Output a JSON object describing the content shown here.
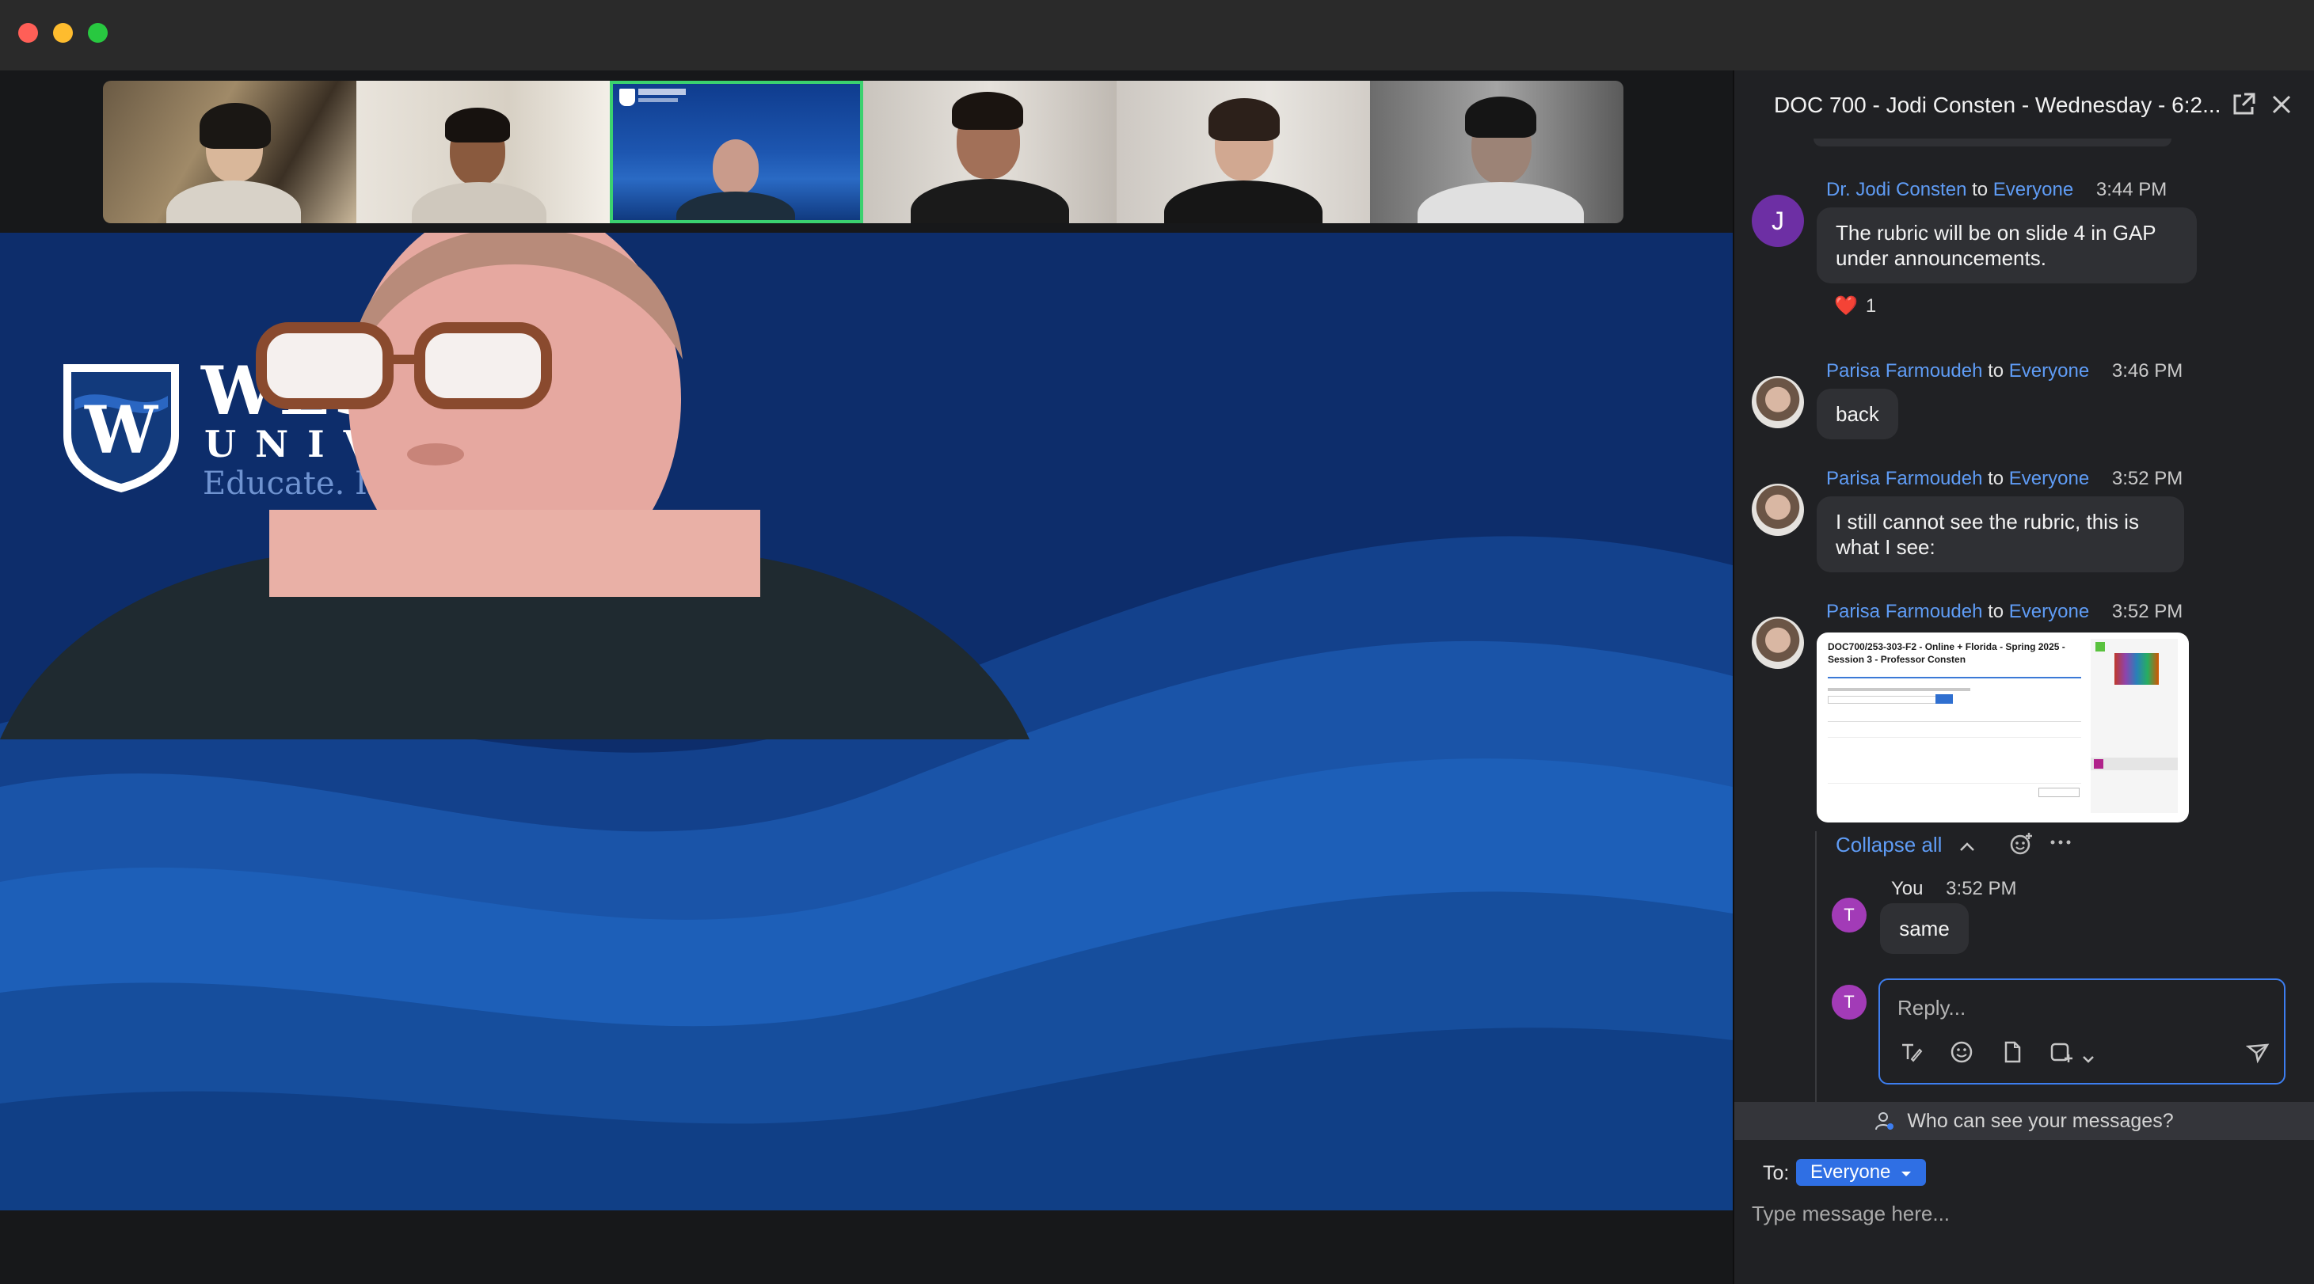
{
  "window": {
    "controls": [
      "close",
      "minimize",
      "zoom"
    ]
  },
  "video_strip": {
    "tiles": [
      "participant-1",
      "participant-2",
      "participant-3-active",
      "participant-4",
      "participant-5",
      "participant-6"
    ],
    "active_tile_color": "#3bd16f"
  },
  "main_video": {
    "logo_name": "WESTCLIFF",
    "logo_sub": "UNIVERSITY",
    "logo_tagline": "Educate. Inspire. Empower.",
    "background_color": "#0d2d6b"
  },
  "chat": {
    "title": "DOC 700 - Jodi Consten - Wednesday - 6:2...",
    "popout_icon": "popout-icon",
    "close_icon": "close-icon",
    "messages": [
      {
        "sender": "Dr. Jodi Consten",
        "to_word": "to",
        "recipient": "Everyone",
        "time": "3:44 PM",
        "avatar_letter": "J",
        "text": "The rubric will be on slide 4 in GAP under announcements.",
        "reaction_emoji": "❤️",
        "reaction_count": "1"
      },
      {
        "sender": "Parisa Farmoudeh",
        "to_word": "to",
        "recipient": "Everyone",
        "time": "3:46 PM",
        "text": "back"
      },
      {
        "sender": "Parisa Farmoudeh",
        "to_word": "to",
        "recipient": "Everyone",
        "time": "3:52 PM",
        "text": "I still cannot see the rubric, this is what I see:"
      },
      {
        "sender": "Parisa Farmoudeh",
        "to_word": "to",
        "recipient": "Everyone",
        "time": "3:52 PM",
        "attachment_title": "DOC700/253-303-F2 - Online + Florida - Spring 2025 - Session 3 - Professor Consten"
      }
    ],
    "thread": {
      "collapse_label": "Collapse all",
      "reply": {
        "sender": "You",
        "time": "3:52 PM",
        "avatar_letter": "T",
        "text": "same"
      },
      "reply_placeholder": "Reply..."
    },
    "privacy_text": "Who can see your messages?",
    "to_label": "To:",
    "recipient_selected": "Everyone",
    "input_placeholder": "Type message here..."
  },
  "colors": {
    "accent": "#3d7ef0",
    "link": "#5f9cf5",
    "panel_bg": "#202124",
    "bubble_bg": "#2f3034"
  }
}
